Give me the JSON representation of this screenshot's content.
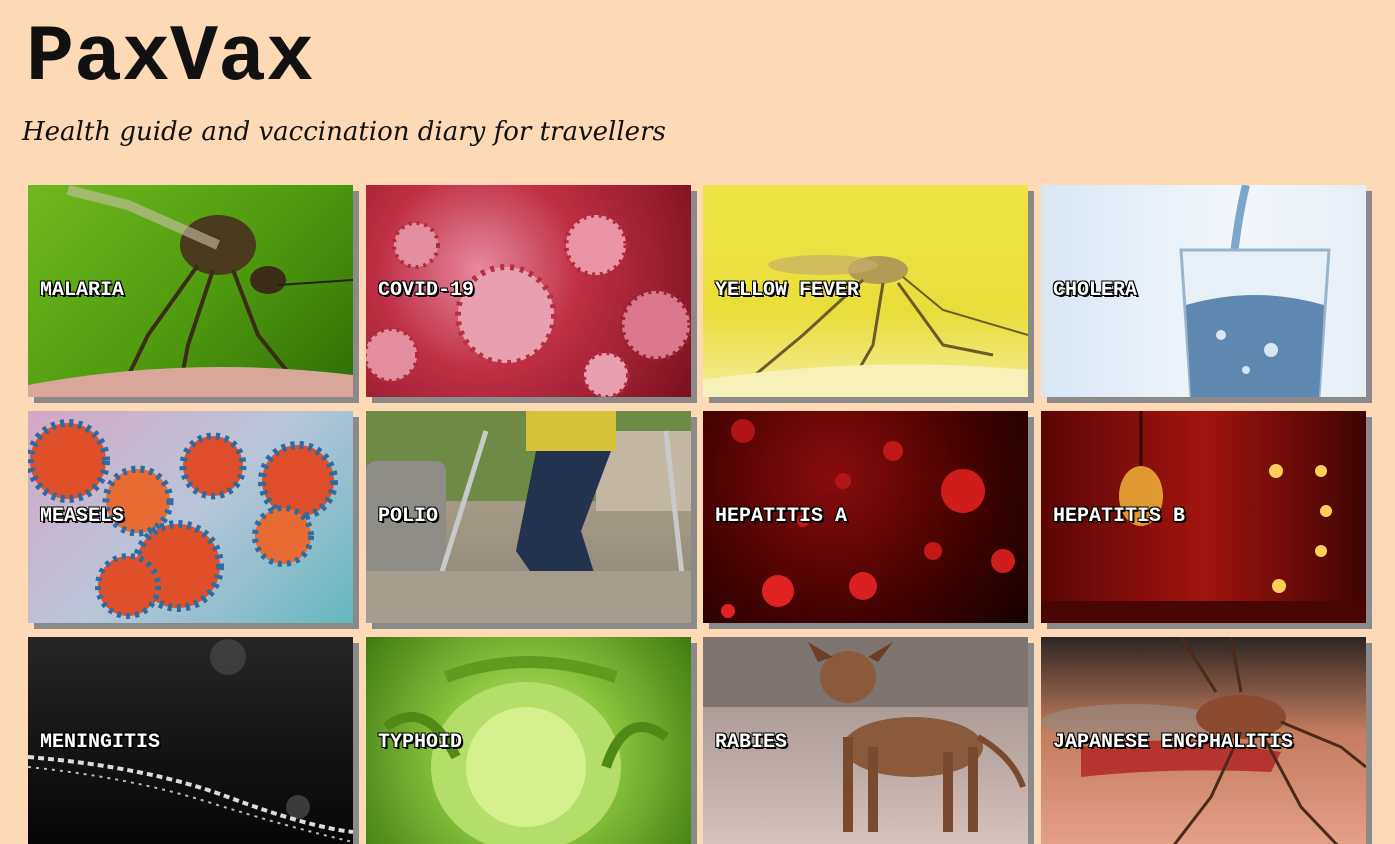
{
  "header": {
    "brand": "PaxVax",
    "tagline": "Health guide and vaccination diary for travellers"
  },
  "tiles": [
    {
      "label": "MALARIA",
      "image": "mosquito-on-skin"
    },
    {
      "label": "COVID-19",
      "image": "coronavirus-particles"
    },
    {
      "label": "YELLOW FEVER",
      "image": "mosquito-yellow-background"
    },
    {
      "label": "CHOLERA",
      "image": "glass-of-water"
    },
    {
      "label": "MEASELS",
      "image": "virus-particles"
    },
    {
      "label": "POLIO",
      "image": "child-with-crutches"
    },
    {
      "label": "HEPATITIS A",
      "image": "red-blood-droplets"
    },
    {
      "label": "HEPATITIS B",
      "image": "red-light-bulbs"
    },
    {
      "label": "MENINGITIS",
      "image": "water-splash-dark"
    },
    {
      "label": "TYPHOID",
      "image": "lettuce"
    },
    {
      "label": "RABIES",
      "image": "stray-dog"
    },
    {
      "label": "JAPANESE ENCPHALITIS",
      "image": "mosquito-on-skin-closeup"
    }
  ]
}
